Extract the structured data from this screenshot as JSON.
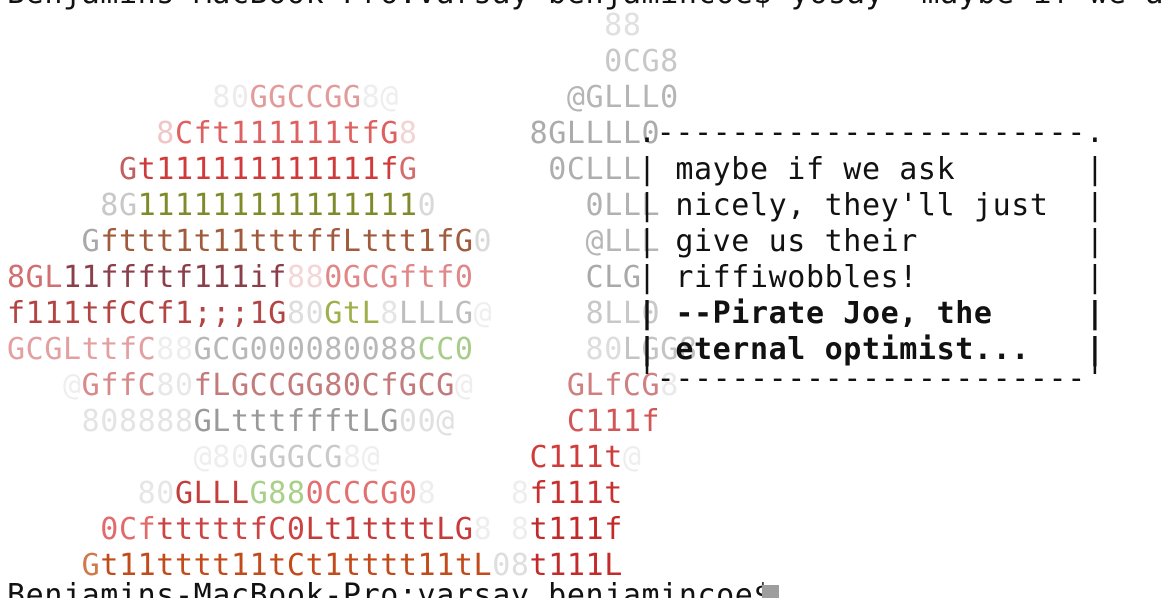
{
  "terminal": {
    "top_partial": "Benjamins-MacBook-Pro:varsay benjamincoe$ yosay 'maybe if we ask nicely, they'll just give us their riffiwobbles!' --Pirate Joe",
    "ascii_art": [
      [
        {
          "t": "                                88",
          "c": "#e0e0e0"
        }
      ],
      [
        {
          "t": "                                0CG8",
          "c": "#c8c8c8"
        }
      ],
      [
        {
          "t": "           80",
          "c": "#ececec"
        },
        {
          "t": "GGCCGG",
          "c": "#e39a9a"
        },
        {
          "t": "8@",
          "c": "#eeeeee"
        },
        {
          "t": "         @GLLL0",
          "c": "#b5b5b5"
        }
      ],
      [
        {
          "t": "        8",
          "c": "#f0c6c6"
        },
        {
          "t": "Cft111111tfG",
          "c": "#df6060"
        },
        {
          "t": "8",
          "c": "#f2d4d4"
        },
        {
          "t": "      8GLLLL0",
          "c": "#ababab"
        }
      ],
      [
        {
          "t": "      G",
          "c": "#c06060"
        },
        {
          "t": "t111111111111f",
          "c": "#d03a3a"
        },
        {
          "t": "G",
          "c": "#d66d6d"
        },
        {
          "t": "       0CLLL",
          "c": "#aeaeae"
        }
      ],
      [
        {
          "t": "     8G",
          "c": "#c8c8c8"
        },
        {
          "t": "111111111111111",
          "c": "#7f8a2a"
        },
        {
          "t": "0",
          "c": "#d9d9d9"
        },
        {
          "t": "        0LLL",
          "c": "#b1b1b1"
        }
      ],
      [
        {
          "t": "    G",
          "c": "#a8a8a8"
        },
        {
          "t": "fttt1t11tttffLttt1fG",
          "c": "#a05a3c"
        },
        {
          "t": "0",
          "c": "#dadada"
        },
        {
          "t": "     @LLL",
          "c": "#b6b6b6"
        }
      ],
      [
        {
          "t": "8GL",
          "c": "#d07070"
        },
        {
          "t": "11ffftf111if",
          "c": "#8a3f4a"
        },
        {
          "t": "88",
          "c": "#f3d6d6"
        },
        {
          "t": "0GCGftf0",
          "c": "#e08888"
        },
        {
          "t": "      CLG",
          "c": "#a9a9a9"
        }
      ],
      [
        {
          "t": "f111tfCCf1;;;1G",
          "c": "#b34444"
        },
        {
          "t": "80",
          "c": "#dddddd"
        },
        {
          "t": "GtL",
          "c": "#9fb04a"
        },
        {
          "t": "8",
          "c": "#e4e4e4"
        },
        {
          "t": "LLLG",
          "c": "#bdbdbd"
        },
        {
          "t": "@",
          "c": "#efefef"
        },
        {
          "t": "     8LL0",
          "c": "#c8c8c8"
        }
      ],
      [
        {
          "t": "GCGLttfC",
          "c": "#e3a0a0"
        },
        {
          "t": "88",
          "c": "#eeeeee"
        },
        {
          "t": "GCG000080088",
          "c": "#b8b8b8"
        },
        {
          "t": "CC0",
          "c": "#a8cc8a"
        },
        {
          "t": "      80",
          "c": "#dddddd"
        },
        {
          "t": "LGG8",
          "c": "#c4c4c4"
        }
      ],
      [
        {
          "t": "   @",
          "c": "#eeeeee"
        },
        {
          "t": "GffC",
          "c": "#d88a8a"
        },
        {
          "t": "80",
          "c": "#e8e8e8"
        },
        {
          "t": "fLGCCGG80CfGCG",
          "c": "#c27a7a"
        },
        {
          "t": "@",
          "c": "#eeeeee"
        },
        {
          "t": "     GLfCG",
          "c": "#d08080"
        },
        {
          "t": "8",
          "c": "#eaeaea"
        }
      ],
      [
        {
          "t": "    808888",
          "c": "#e4e4e4"
        },
        {
          "t": "GLtttffftLG",
          "c": "#9a9a9a"
        },
        {
          "t": "00@",
          "c": "#e0e0e0"
        },
        {
          "t": "      C111f",
          "c": "#d35555"
        }
      ],
      [
        {
          "t": "          @80",
          "c": "#eeeeee"
        },
        {
          "t": "GGGCG",
          "c": "#c9c9c9"
        },
        {
          "t": "8@",
          "c": "#eeeeee"
        },
        {
          "t": "        C111t",
          "c": "#d03c3c"
        },
        {
          "t": "@",
          "c": "#eeeeee"
        }
      ],
      [
        {
          "t": "       80",
          "c": "#e6e6e6"
        },
        {
          "t": "GLLL",
          "c": "#c43c3c"
        },
        {
          "t": "G88",
          "c": "#a8d088"
        },
        {
          "t": "0CCCG0",
          "c": "#e37070"
        },
        {
          "t": "8",
          "c": "#eeeeee"
        },
        {
          "t": "    8",
          "c": "#eeeeee"
        },
        {
          "t": "f111t",
          "c": "#c93030"
        }
      ],
      [
        {
          "t": "     0Cf",
          "c": "#e36a6a"
        },
        {
          "t": "tttttfC0",
          "c": "#cc4444"
        },
        {
          "t": "Lt1ttttLG",
          "c": "#c63a3a"
        },
        {
          "t": "8",
          "c": "#eeeeee"
        },
        {
          "t": " 8",
          "c": "#eeeeee"
        },
        {
          "t": "t111f",
          "c": "#c22a2a"
        }
      ],
      [
        {
          "t": "    G",
          "c": "#d07a4a"
        },
        {
          "t": "t11tttt11tCt1tttt11tL",
          "c": "#c34a1a"
        },
        {
          "t": "08",
          "c": "#dedede"
        },
        {
          "t": "t111L",
          "c": "#c32a2a"
        }
      ]
    ],
    "bubble": {
      "top_border": ".-----------------------.",
      "lines": [
        {
          "text": "| maybe if we ask       |",
          "bold": false
        },
        {
          "text": "| nicely, they'll just  |",
          "bold": false
        },
        {
          "text": "| give us their         |",
          "bold": false
        },
        {
          "text": "| riffiwobbles!         |",
          "bold": false
        },
        {
          "text": "| --Pirate Joe, the     |",
          "bold": true
        },
        {
          "text": "| eternal optimist...   |",
          "bold": true
        }
      ],
      "bottom_border": "'-----------------------'"
    },
    "prompt": "Benjamins-MacBook-Pro:varsay benjamincoe$ "
  }
}
